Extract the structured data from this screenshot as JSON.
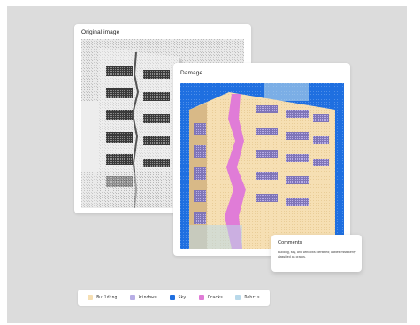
{
  "cards": {
    "original": {
      "title": "Original image"
    },
    "damage": {
      "title": "Damage"
    },
    "comments": {
      "title": "Comments",
      "body": "Building, sky, and windows identified; cables mistakenly classified as cracks."
    }
  },
  "legend": [
    {
      "label": "Building",
      "color": "#f6dfb3"
    },
    {
      "label": "Windows",
      "color": "#b8aee6"
    },
    {
      "label": "Sky",
      "color": "#1f6fe0"
    },
    {
      "label": "Cracks",
      "color": "#e07cd7"
    },
    {
      "label": "Debris",
      "color": "#b9d9ea"
    }
  ]
}
